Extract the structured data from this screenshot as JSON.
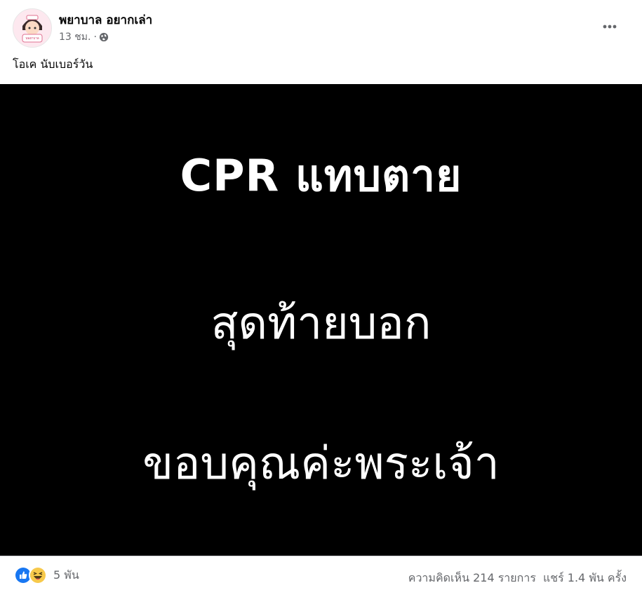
{
  "post": {
    "author": "พยาบาล อยากเล่า",
    "avatar_text": "นพยาบาล อยากเล่า",
    "time": "13 ชม.",
    "separator": "·",
    "audience_icon": "globe-icon",
    "more_icon": "more-options-icon",
    "caption": "โอเค นับเบอร์วัน"
  },
  "image": {
    "lines": [
      "CPR แทบตาย",
      "สุดท้ายบอก",
      "ขอบคุณค่ะพระเจ้า"
    ],
    "background": "#000000",
    "text_color": "#ffffff"
  },
  "footer": {
    "reaction_icons": [
      "like-icon",
      "haha-icon"
    ],
    "reaction_count": "5 พัน",
    "comments": "ความคิดเห็น 214 รายการ",
    "shares": "แชร์ 1.4 พัน ครั้ง"
  },
  "colors": {
    "like_blue": "#1877f2",
    "haha_yellow": "#f7c94b",
    "secondary_text": "#65676b"
  }
}
